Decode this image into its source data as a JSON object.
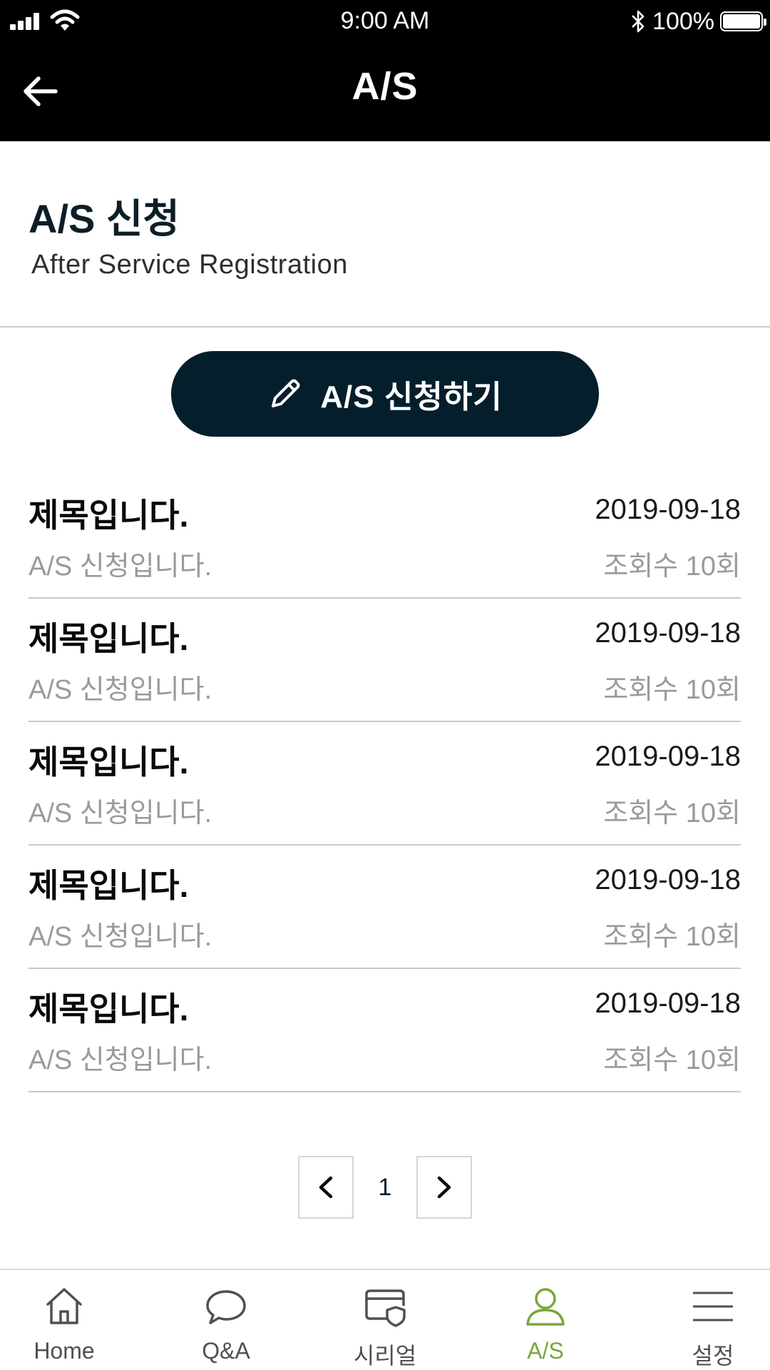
{
  "status_bar": {
    "time": "9:00 AM",
    "battery": "100%"
  },
  "nav": {
    "title": "A/S"
  },
  "header": {
    "title": "A/S 신청",
    "subtitle": "After Service Registration"
  },
  "apply_button": {
    "label": "A/S 신청하기"
  },
  "posts": [
    {
      "title": "제목입니다.",
      "date": "2019-09-18",
      "desc": "A/S 신청입니다.",
      "views": "조회수 10회"
    },
    {
      "title": "제목입니다.",
      "date": "2019-09-18",
      "desc": "A/S 신청입니다.",
      "views": "조회수 10회"
    },
    {
      "title": "제목입니다.",
      "date": "2019-09-18",
      "desc": "A/S 신청입니다.",
      "views": "조회수 10회"
    },
    {
      "title": "제목입니다.",
      "date": "2019-09-18",
      "desc": "A/S 신청입니다.",
      "views": "조회수 10회"
    },
    {
      "title": "제목입니다.",
      "date": "2019-09-18",
      "desc": "A/S 신청입니다.",
      "views": "조회수 10회"
    }
  ],
  "pagination": {
    "current": "1"
  },
  "tabs": [
    {
      "label": "Home",
      "icon": "home-icon"
    },
    {
      "label": "Q&A",
      "icon": "chat-bubble-icon"
    },
    {
      "label": "시리얼",
      "icon": "card-shield-icon"
    },
    {
      "label": "A/S",
      "icon": "user-icon",
      "active": true
    },
    {
      "label": "설정",
      "icon": "menu-icon"
    }
  ],
  "colors": {
    "accent": "#7aa63a",
    "button": "#051e2c",
    "header": "#000000"
  }
}
